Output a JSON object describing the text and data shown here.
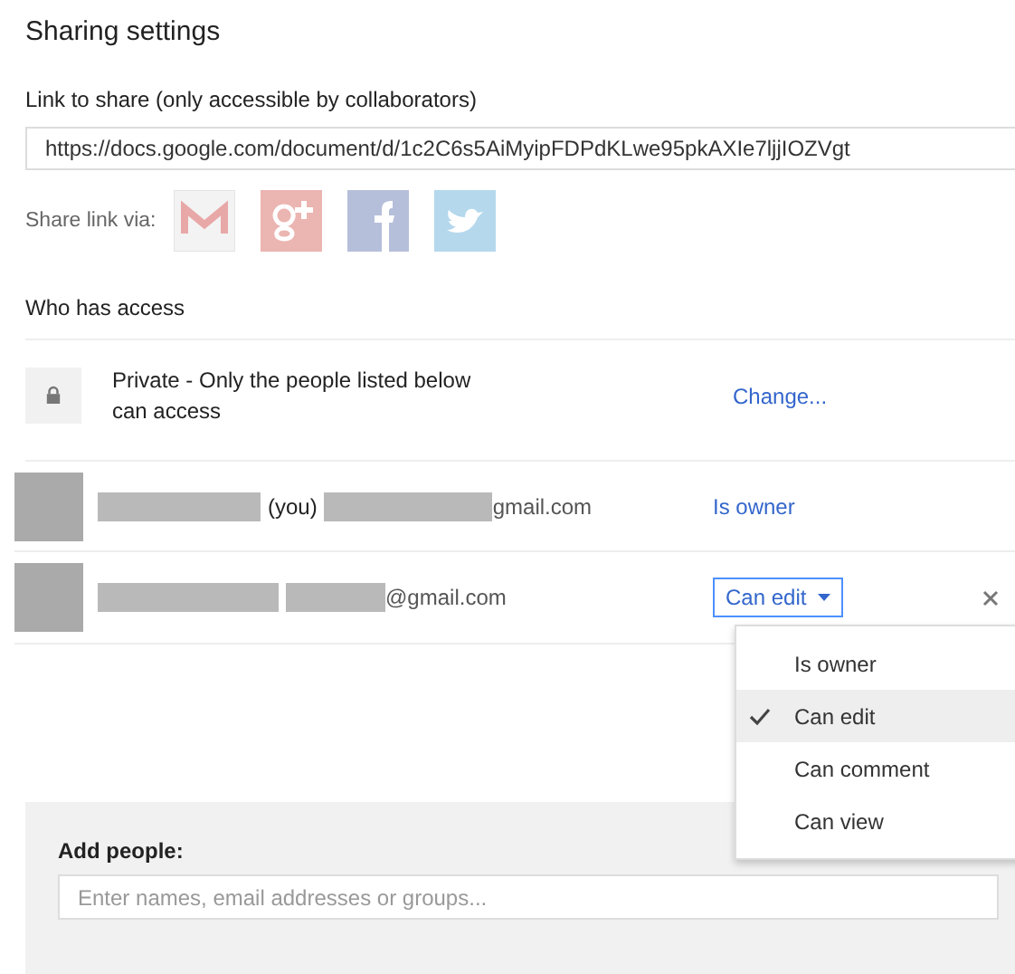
{
  "dialog": {
    "title": "Sharing settings"
  },
  "link": {
    "label": "Link to share (only accessible by collaborators)",
    "value": "https://docs.google.com/document/d/1c2C6s5AiMyipFDPdKLwe95pkAXIe7ljjIOZVgt"
  },
  "share_via": {
    "label": "Share link via:",
    "services": [
      {
        "kind": "gmail"
      },
      {
        "kind": "gplus"
      },
      {
        "kind": "facebook"
      },
      {
        "kind": "twitter"
      }
    ]
  },
  "access": {
    "heading": "Who has access",
    "visibility": {
      "text": "Private - Only the people listed below can access",
      "action": "Change..."
    },
    "people": [
      {
        "you_label": "(you)",
        "email": "gmail.com",
        "role": "Is owner",
        "kind": "owner"
      },
      {
        "email": "@gmail.com",
        "role": "Can edit",
        "kind": "collaborator",
        "menu_open": true
      }
    ]
  },
  "role_menu": [
    {
      "label": "Is owner",
      "selected": false
    },
    {
      "label": "Can edit",
      "selected": true
    },
    {
      "label": "Can comment",
      "selected": false
    },
    {
      "label": "Can view",
      "selected": false
    }
  ],
  "add_people": {
    "label": "Add people:",
    "placeholder": "Enter names, email addresses or groups..."
  }
}
